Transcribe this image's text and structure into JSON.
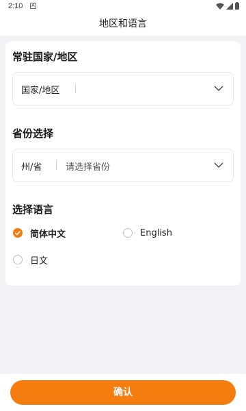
{
  "status_bar": {
    "time": "2:10",
    "app_icon": "A"
  },
  "header": {
    "title": "地区和语言"
  },
  "country_section": {
    "title": "常驻国家/地区",
    "prefix": "国家/地区",
    "value": "",
    "chevron": "chevron-down-icon"
  },
  "province_section": {
    "title": "省份选择",
    "prefix": "州/省",
    "placeholder": "请选择省份",
    "chevron": "chevron-down-icon"
  },
  "language_section": {
    "title": "选择语言",
    "options": [
      {
        "label": "简体中文",
        "selected": true
      },
      {
        "label": "English",
        "selected": false
      },
      {
        "label": "日文",
        "selected": false
      }
    ]
  },
  "footer": {
    "confirm_label": "确认"
  },
  "colors": {
    "accent": "#f57c0e",
    "background": "#f2f2f6",
    "card": "#ffffff"
  }
}
